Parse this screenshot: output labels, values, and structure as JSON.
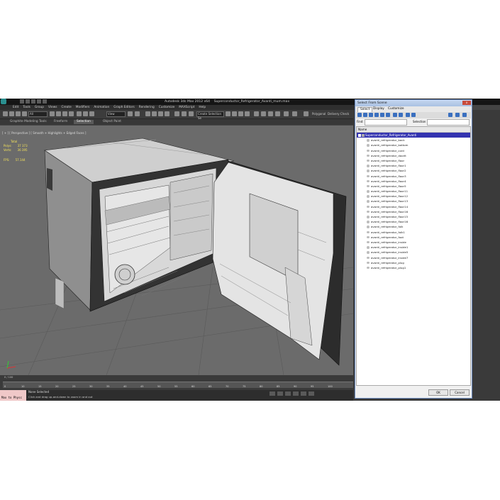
{
  "app_title": "Autodesk 3ds Max 2012 x64",
  "file_name": "Superconductor_Refrigerator_Avanti_mum.max",
  "menu": [
    "Edit",
    "Tools",
    "Group",
    "Views",
    "Create",
    "Modifiers",
    "Animation",
    "Graph Editors",
    "Rendering",
    "Customize",
    "MAXScript",
    "Help"
  ],
  "toolbar": {
    "selection_filter": "All",
    "view_dropdown": "View",
    "create_selection": "Create Selection Se",
    "polygonal": "Polygonal",
    "delivery_check": "Delivery Check"
  },
  "ribbon_tabs": [
    {
      "label": "Graphite Modeling Tools",
      "active": false
    },
    {
      "label": "Freeform",
      "active": false
    },
    {
      "label": "Selection",
      "active": true
    },
    {
      "label": "Object Paint",
      "active": false
    }
  ],
  "viewport": {
    "label": "[ + ] [ Perspective ] [ Smooth + Highlights + Edged Faces ]",
    "stats": {
      "total_label": "Total",
      "polys_label": "Polys:",
      "polys_value": "37 373",
      "verts_label": "Verts:",
      "verts_value": "36 395",
      "fps_label": "FPS:",
      "fps_value": "57.144"
    }
  },
  "timeline": {
    "slider_label": "0 / 100",
    "ticks": [
      "0",
      "10",
      "15",
      "20",
      "25",
      "30",
      "35",
      "40",
      "45",
      "50",
      "55",
      "60",
      "65",
      "70",
      "75",
      "80",
      "85",
      "90",
      "95",
      "100"
    ]
  },
  "status": {
    "maxscript_label": "Max to Physc",
    "line1": "None Selected",
    "line2": "Click and drag up-and-down to zoom in and out"
  },
  "dialog": {
    "title": "Select From Scene",
    "close": "x",
    "tabs": [
      {
        "label": "Select",
        "active": true
      },
      {
        "label": "Display",
        "active": false
      },
      {
        "label": "Customize",
        "active": false
      }
    ],
    "find_label": "Find:",
    "find_value": "",
    "selection_set_label": "Selection Set:",
    "column_header": "Name",
    "root_item": "Superconductor_Refrigerator_Avanti",
    "items": [
      "avanti_refrigerator_back",
      "avanti_refrigerator_bottom",
      "avanti_refrigerator_cord",
      "avanti_refrigerator_doorit",
      "avanti_refrigerator_floor",
      "avanti_refrigerator_floor1",
      "avanti_refrigerator_floor2",
      "avanti_refrigerator_floor3",
      "avanti_refrigerator_floor4",
      "avanti_refrigerator_floor5",
      "avanti_refrigerator_floor11",
      "avanti_refrigerator_floor12",
      "avanti_refrigerator_floor13",
      "avanti_refrigerator_floor14",
      "avanti_refrigerator_floor16",
      "avanti_refrigerator_floor15",
      "avanti_refrigerator_floor16",
      "avanti_refrigerator_folk",
      "avanti_refrigerator_folk1",
      "avanti_refrigerator_foot",
      "avanti_refrigerator_inside",
      "avanti_refrigerator_inside1",
      "avanti_refrigerator_inside5",
      "avanti_refrigerator_inside7",
      "avanti_refrigerator_plug",
      "avanti_refrigerator_plug1"
    ],
    "ok_label": "OK",
    "cancel_label": "Cancel"
  },
  "colors": {
    "viewport_bg": "#6b6b6b",
    "dialog_selection": "#3333b0",
    "stats_text": "#f5e35a",
    "maxscript_bg": "#f0c8c8"
  }
}
